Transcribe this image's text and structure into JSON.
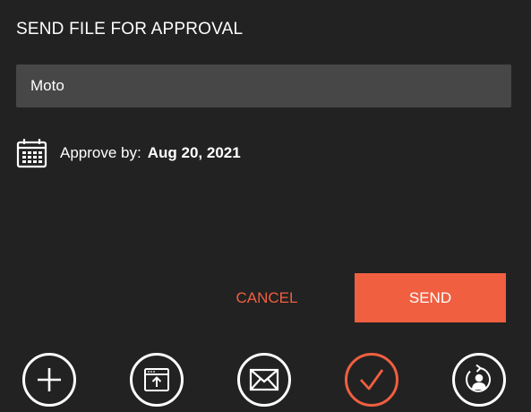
{
  "dialog": {
    "title": "SEND FILE FOR APPROVAL",
    "name_field": {
      "value": "Moto",
      "placeholder": ""
    },
    "approve_label": "Approve by:",
    "approve_date": "Aug 20, 2021",
    "cancel_label": "CANCEL",
    "send_label": "SEND"
  },
  "toolbar": {
    "items": [
      {
        "icon": "plus-icon",
        "active": false
      },
      {
        "icon": "upload-window-icon",
        "active": false
      },
      {
        "icon": "mail-icon",
        "active": false
      },
      {
        "icon": "checkmark-icon",
        "active": true
      },
      {
        "icon": "user-share-icon",
        "active": false
      }
    ]
  },
  "colors": {
    "background": "#222222",
    "field": "#474747",
    "accent": "#f05f40",
    "text": "#ffffff"
  }
}
